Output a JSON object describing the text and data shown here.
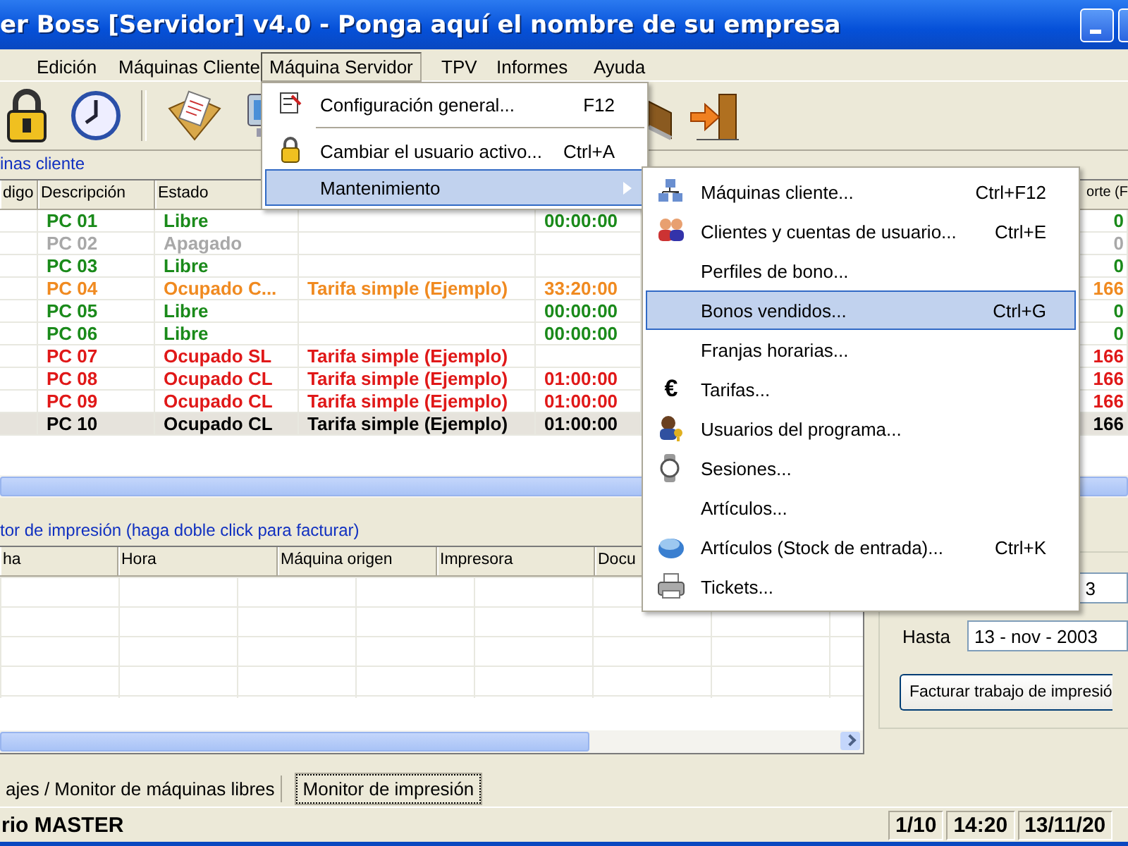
{
  "window": {
    "title": "er Boss [Servidor] v4.0 - Ponga aquí el nombre de su empresa"
  },
  "menu_bar": [
    {
      "label": "Edición",
      "selected": false
    },
    {
      "label": "Máquinas Cliente",
      "selected": false
    },
    {
      "label": "Máquina Servidor",
      "selected": true
    },
    {
      "label": "TPV",
      "selected": false
    },
    {
      "label": "Informes",
      "selected": false
    },
    {
      "label": "Ayuda",
      "selected": false
    }
  ],
  "machines_panel": {
    "title": "inas cliente",
    "columns": [
      "digo",
      "Descripción",
      "Estado"
    ],
    "last_column": "orte (F",
    "rows": [
      {
        "description": "PC 01",
        "state": "Libre",
        "color": "#1a8a1a",
        "time": "00:00:00",
        "column_7": "0",
        "selected": false
      },
      {
        "description": "PC 02",
        "state": "Apagado",
        "color": "#a8a8a8",
        "column_7": "0",
        "selected": false
      },
      {
        "description": "PC 03",
        "state": "Libre",
        "color": "#1a8a1a",
        "column_7": "0",
        "selected": false
      },
      {
        "description": "PC 04",
        "state": "Ocupado C...",
        "color": "#f08a20",
        "rate": "Tarifa simple (Ejemplo)",
        "time": "33:20:00",
        "column_7": "166",
        "selected": false
      },
      {
        "description": "PC 05",
        "state": "Libre",
        "color": "#1a8a1a",
        "time": "00:00:00",
        "column_7": "0",
        "selected": false
      },
      {
        "description": "PC 06",
        "state": "Libre",
        "color": "#1a8a1a",
        "time": "00:00:00",
        "column_7": "0",
        "selected": false
      },
      {
        "description": "PC 07",
        "state": "Ocupado SL",
        "color": "#e01818",
        "rate": "Tarifa simple (Ejemplo)",
        "column_7": "166",
        "selected": false
      },
      {
        "description": "PC 08",
        "state": "Ocupado CL",
        "color": "#e01818",
        "rate": "Tarifa simple (Ejemplo)",
        "time": "01:00:00",
        "column_7": "166",
        "selected": false
      },
      {
        "description": "PC 09",
        "state": "Ocupado CL",
        "color": "#e01818",
        "rate": "Tarifa simple (Ejemplo)",
        "time": "01:00:00",
        "column_7": "166",
        "selected": false
      },
      {
        "description": "PC 10",
        "state": "Ocupado CL",
        "color": "#000000",
        "rate": "Tarifa simple (Ejemplo)",
        "time": "01:00:00",
        "column_7": "166",
        "selected": true
      }
    ]
  },
  "print_panel": {
    "title": "tor de impresión (haga doble click para facturar)",
    "columns": [
      "ha",
      "Hora",
      "Máquina origen",
      "Impresora",
      "Docu"
    ]
  },
  "date_filter": {
    "from_value": "3",
    "to_label": "Hasta",
    "to_value": "13 - nov - 2003",
    "button": "Facturar trabajo de impresió"
  },
  "tabs": [
    {
      "label": "ajes / Monitor de máquinas libres",
      "selected": false
    },
    {
      "label": "Monitor de impresión",
      "selected": true
    }
  ],
  "status_bar": [
    "rio MASTER",
    "1/10",
    "14:20",
    "13/11/20"
  ],
  "dropdown_menu": {
    "items": [
      {
        "kind": "item",
        "label": "Configuración general...",
        "shortcut": "F12",
        "selected": false
      },
      {
        "kind": "separator"
      },
      {
        "kind": "item",
        "label": "Cambiar el usuario activo...",
        "shortcut": "Ctrl+A",
        "selected": false
      },
      {
        "kind": "submenu",
        "label": "Mantenimiento",
        "selected": true
      }
    ]
  },
  "submenu": {
    "items": [
      {
        "label": "Máquinas cliente...",
        "shortcut": "Ctrl+F12",
        "selected": false
      },
      {
        "label": "Clientes y cuentas de usuario...",
        "shortcut": "Ctrl+E",
        "selected": false
      },
      {
        "label": "Perfiles de bono...",
        "selected": false
      },
      {
        "label": "Bonos vendidos...",
        "shortcut": "Ctrl+G",
        "selected": true
      },
      {
        "label": "Franjas horarias...",
        "selected": false
      },
      {
        "label": "Tarifas...",
        "glyph": "€",
        "selected": false
      },
      {
        "label": "Usuarios del programa...",
        "selected": false
      },
      {
        "label": "Sesiones...",
        "selected": false
      },
      {
        "label": "Artículos...",
        "selected": false
      },
      {
        "label": "Artículos (Stock de entrada)...",
        "shortcut": "Ctrl+K",
        "selected": false
      },
      {
        "label": "Tickets...",
        "selected": false
      }
    ]
  }
}
